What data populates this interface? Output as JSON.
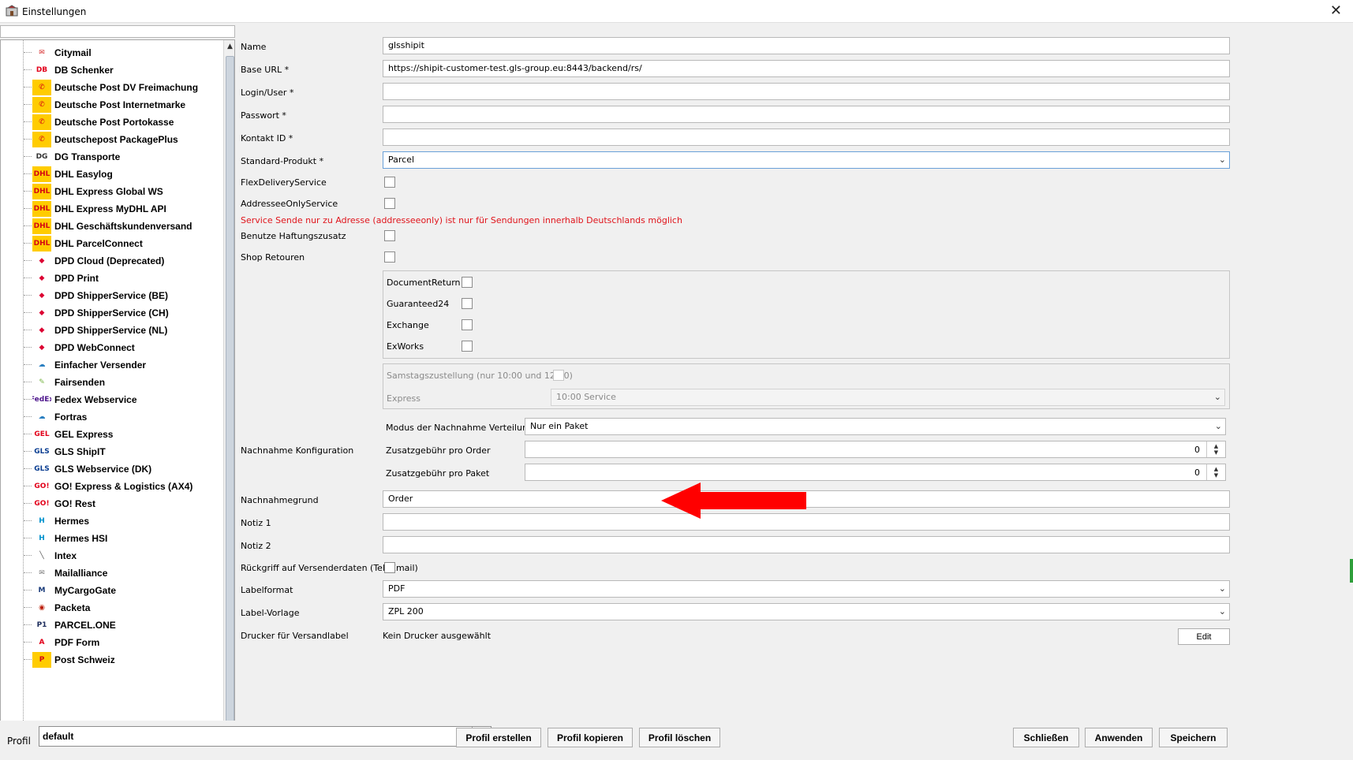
{
  "window": {
    "title": "Einstellungen"
  },
  "providers": [
    {
      "label": "Citymail",
      "logo": "✉",
      "color": "#d62828"
    },
    {
      "label": "DB Schenker",
      "logo": "DB",
      "color": "#e2001a"
    },
    {
      "label": "Deutsche Post DV Freimachung",
      "logo": "✆",
      "color": "#ffcc00"
    },
    {
      "label": "Deutsche Post Internetmarke",
      "logo": "✆",
      "color": "#ffcc00"
    },
    {
      "label": "Deutsche Post Portokasse",
      "logo": "✆",
      "color": "#ffcc00"
    },
    {
      "label": "Deutschepost PackagePlus",
      "logo": "✆",
      "color": "#ffcc00"
    },
    {
      "label": "DG Transporte",
      "logo": "DG",
      "color": "#333333"
    },
    {
      "label": "DHL Easylog",
      "logo": "DHL",
      "color": "#ffcc00"
    },
    {
      "label": "DHL Express Global WS",
      "logo": "DHL",
      "color": "#ffcc00"
    },
    {
      "label": "DHL Express MyDHL API",
      "logo": "DHL",
      "color": "#ffcc00"
    },
    {
      "label": "DHL Geschäftskundenversand",
      "logo": "DHL",
      "color": "#ffcc00"
    },
    {
      "label": "DHL ParcelConnect",
      "logo": "DHL",
      "color": "#ffcc00"
    },
    {
      "label": "DPD Cloud (Deprecated)",
      "logo": "◆",
      "color": "#dc0032"
    },
    {
      "label": "DPD Print",
      "logo": "◆",
      "color": "#dc0032"
    },
    {
      "label": "DPD ShipperService (BE)",
      "logo": "◆",
      "color": "#dc0032"
    },
    {
      "label": "DPD ShipperService (CH)",
      "logo": "◆",
      "color": "#dc0032"
    },
    {
      "label": "DPD ShipperService (NL)",
      "logo": "◆",
      "color": "#dc0032"
    },
    {
      "label": "DPD WebConnect",
      "logo": "◆",
      "color": "#dc0032"
    },
    {
      "label": "Einfacher Versender",
      "logo": "☁",
      "color": "#2a7fc1"
    },
    {
      "label": "Fairsenden",
      "logo": "✎",
      "color": "#7ab648"
    },
    {
      "label": "Fedex Webservice",
      "logo": "FedEx",
      "color": "#4d148c"
    },
    {
      "label": "Fortras",
      "logo": "☁",
      "color": "#2a7fc1"
    },
    {
      "label": "GEL Express",
      "logo": "GEL",
      "color": "#e2001a"
    },
    {
      "label": "GLS ShipIT",
      "logo": "GLS",
      "color": "#0a3d91"
    },
    {
      "label": "GLS Webservice (DK)",
      "logo": "GLS",
      "color": "#0a3d91"
    },
    {
      "label": "GO! Express & Logistics (AX4)",
      "logo": "GO!",
      "color": "#e2001a"
    },
    {
      "label": "GO! Rest",
      "logo": "GO!",
      "color": "#e2001a"
    },
    {
      "label": "Hermes",
      "logo": "H",
      "color": "#0091cd"
    },
    {
      "label": "Hermes HSI",
      "logo": "H",
      "color": "#0091cd"
    },
    {
      "label": "Intex",
      "logo": "╲",
      "color": "#555555"
    },
    {
      "label": "Mailalliance",
      "logo": "✉",
      "color": "#777777"
    },
    {
      "label": "MyCargoGate",
      "logo": "M",
      "color": "#1a3b7a"
    },
    {
      "label": "Packeta",
      "logo": "◉",
      "color": "#ba1b02"
    },
    {
      "label": "PARCEL.ONE",
      "logo": "P1",
      "color": "#1a2a5a"
    },
    {
      "label": "PDF Form",
      "logo": "A",
      "color": "#e2001a"
    },
    {
      "label": "Post Schweiz",
      "logo": "P",
      "color": "#ffcc00"
    }
  ],
  "form": {
    "name": {
      "label": "Name",
      "value": "glsshipit"
    },
    "base_url": {
      "label": "Base URL *",
      "value": "https://shipit-customer-test.gls-group.eu:8443/backend/rs/"
    },
    "login": {
      "label": "Login/User *",
      "value": ""
    },
    "password": {
      "label": "Passwort *",
      "value": ""
    },
    "contact_id": {
      "label": "Kontakt ID *",
      "value": ""
    },
    "standard_product": {
      "label": "Standard-Produkt *",
      "value": "Parcel"
    },
    "flex_delivery": {
      "label": "FlexDeliveryService"
    },
    "addressee_only": {
      "label": "AddresseeOnlyService"
    },
    "warning": "Service Sende nur zu Adresse (addresseeonly) ist nur für Sendungen innerhalb Deutschlands möglich",
    "liability": {
      "label": "Benutze Haftungszusatz"
    },
    "shop_returns": {
      "label": "Shop Retouren"
    },
    "return_options": {
      "document_return": "DocumentReturn",
      "guaranteed24": "Guaranteed24",
      "exchange": "Exchange",
      "exworks": "ExWorks"
    },
    "saturday": {
      "label": "Samstagszustellung (nur 10:00 und 12:00)"
    },
    "express": {
      "label": "Express",
      "value": "10:00 Service"
    },
    "cod": {
      "label": "Nachnahme Konfiguration",
      "mode_label": "Modus der Nachnahme Verteilung",
      "mode_value": "Nur ein Paket",
      "fee_order_label": "Zusatzgebühr pro Order",
      "fee_order_value": "0",
      "fee_package_label": "Zusatzgebühr pro Paket",
      "fee_package_value": "0"
    },
    "cod_reason": {
      "label": "Nachnahmegrund",
      "value": "Order"
    },
    "note1": {
      "label": "Notiz 1",
      "value": ""
    },
    "note2": {
      "label": "Notiz 2",
      "value": ""
    },
    "sender_fallback": {
      "label": "Rückgriff auf Versenderdaten (Tel, Email)"
    },
    "label_format": {
      "label": "Labelformat",
      "value": "PDF"
    },
    "label_template": {
      "label": "Label-Vorlage",
      "value": "ZPL 200"
    },
    "printer": {
      "label": "Drucker für Versandlabel",
      "value": "Kein Drucker ausgewählt",
      "edit_label": "Edit"
    }
  },
  "bottom": {
    "profile_label": "Profil",
    "profile_value": "default",
    "create": "Profil erstellen",
    "copy": "Profil kopieren",
    "delete": "Profil löschen",
    "close": "Schließen",
    "apply": "Anwenden",
    "save": "Speichern"
  },
  "colors": {
    "warning": "#e0141b",
    "annotation_arrow": "#ff0000"
  }
}
